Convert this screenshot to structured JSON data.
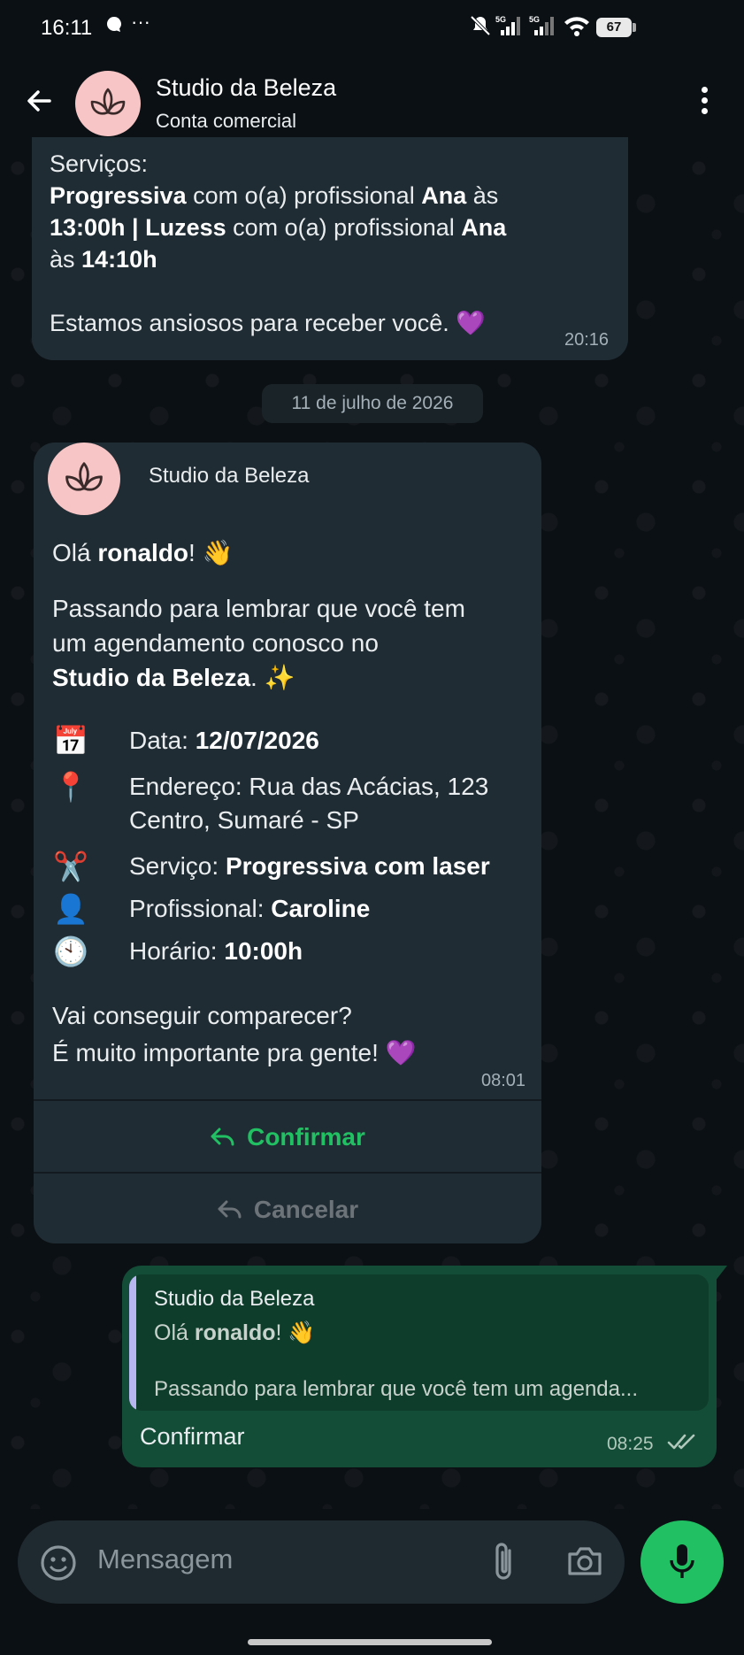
{
  "status_bar": {
    "time": "16:11",
    "battery": "67",
    "network_1": "5G",
    "network_2": "5G"
  },
  "header": {
    "title": "Studio da Beleza",
    "subtitle": "Conta comercial"
  },
  "messages": {
    "first": {
      "line1": "Serviços:",
      "line2_bold_a": "Progressiva",
      "line2_mid": " com o(a) profissional ",
      "line2_bold_b": "Ana",
      "line2_end": " às",
      "line3_bold_a": "13:00h | Luzess",
      "line3_mid": " com o(a) profissional ",
      "line3_bold_b": "Ana",
      "line4_start": "às ",
      "line4_bold": "14:10h",
      "line5": "Estamos ansiosos para receber você. 💜",
      "time": "20:16"
    },
    "date_chip": "11 de julho de 2026",
    "reminder": {
      "business_name": "Studio da Beleza",
      "greeting_start": "Olá ",
      "greeting_name": "ronaldo",
      "greeting_end": "! 👋",
      "p1_line1": "Passando para lembrar que você tem",
      "p1_line2": "um agendamento conosco no",
      "p1_line3_bold": "Studio da Beleza",
      "p1_line3_end": ". ✨",
      "date_label": "Data: ",
      "date_value": "12/07/2026",
      "address_line1": "Endereço: Rua das Acácias, 123",
      "address_line2": "Centro, Sumaré - SP",
      "service_label": "Serviço: ",
      "service_value": "Progressiva com laser",
      "pro_label": "Profissional: ",
      "pro_value": "Caroline",
      "hour_label": "Horário: ",
      "hour_value": "10:00h",
      "closing_line1": "Vai conseguir comparecer?",
      "closing_line2": "É muito importante pra gente! 💜",
      "time": "08:01",
      "confirm_label": "Confirmar",
      "cancel_label": "Cancelar",
      "icons": {
        "calendar": "📅",
        "pin": "📍",
        "scissors": "✂️",
        "person": "👤",
        "clock": "🕙"
      }
    },
    "outgoing": {
      "quoted_name": "Studio da Beleza",
      "quoted_line1_start": "Olá ",
      "quoted_line1_name": "ronaldo",
      "quoted_line1_end": "! 👋",
      "quoted_line2": "Passando para lembrar que você tem um agenda...",
      "reply": "Confirmar",
      "time": "08:25"
    }
  },
  "composer": {
    "placeholder": "Mensagem"
  },
  "colors": {
    "background": "#0b1014",
    "incoming_bubble": "#202c33",
    "outgoing_bubble": "#144d37",
    "accent": "#21c063"
  }
}
